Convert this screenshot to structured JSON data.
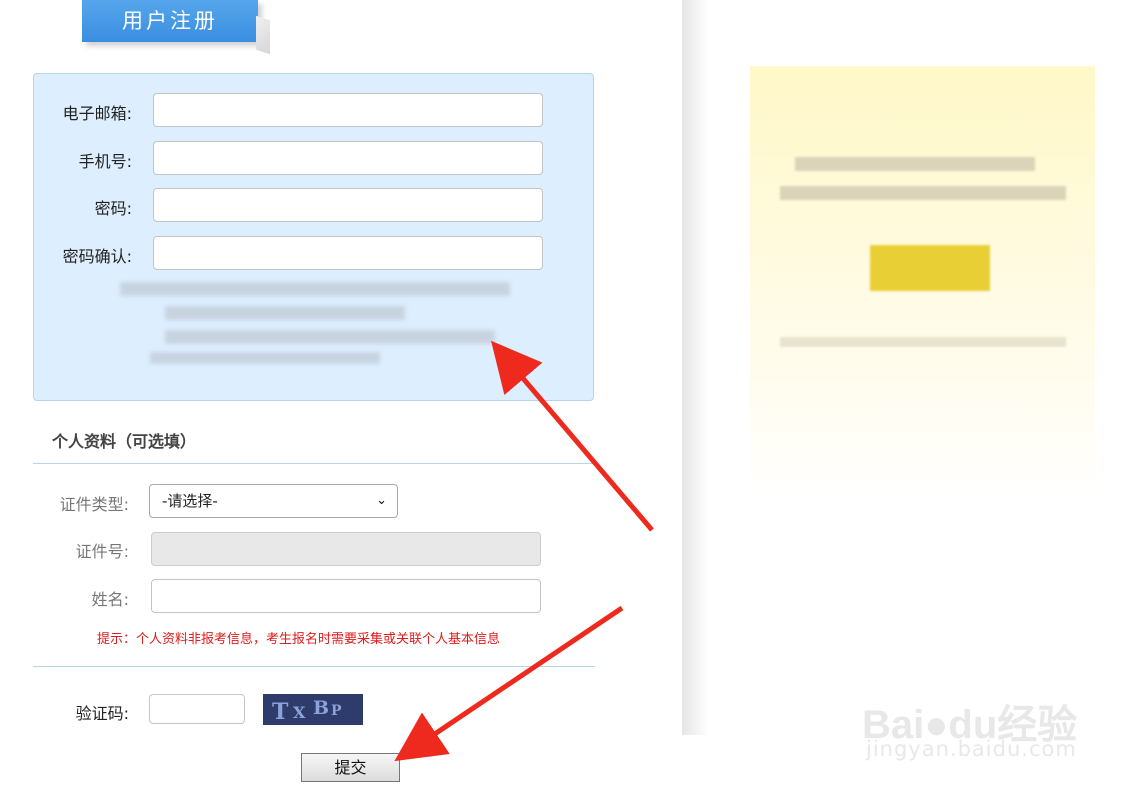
{
  "form": {
    "title": "用户注册",
    "email_label": "电子邮箱:",
    "phone_label": "手机号:",
    "password_label": "密码:",
    "confirm_label": "密码确认:",
    "email_value": "",
    "phone_value": "",
    "password_value": "",
    "confirm_value": ""
  },
  "optional": {
    "section_title": "个人资料（可选填）",
    "id_type_label": "证件类型:",
    "id_type_selected": "-请选择-",
    "id_number_label": "证件号:",
    "name_label": "姓名:",
    "hint": "提示：个人资料非报考信息，考生报名时需要采集或关联个人基本信息"
  },
  "captcha": {
    "label": "验证码:",
    "value": "",
    "image_chars": [
      "T",
      "X",
      "B",
      "P"
    ]
  },
  "submit_label": "提交",
  "watermark": {
    "logo": "Bai",
    "logo_du": "du",
    "logo_cn": "经验",
    "url": "jingyan.baidu.com"
  },
  "colors": {
    "accent_blue": "#3a8ee0",
    "hint_red": "#e01b1b",
    "arrow_red": "#ee2a1f"
  }
}
